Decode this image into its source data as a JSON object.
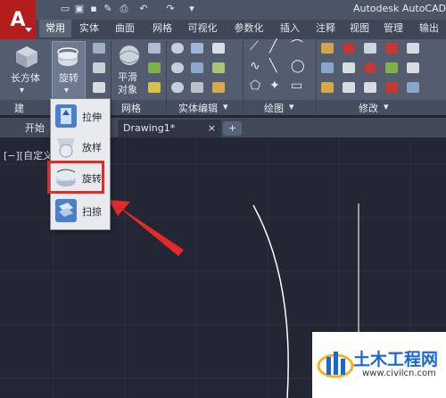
{
  "app": {
    "title": "Autodesk AutoCAD",
    "logo": "A"
  },
  "quick_access": [
    "new-icon",
    "open-icon",
    "save-icon",
    "saveas-icon",
    "print-icon",
    "undo-icon",
    "redo-icon"
  ],
  "ribbon_tabs": [
    "常用",
    "实体",
    "曲面",
    "网格",
    "可视化",
    "参数化",
    "插入",
    "注释",
    "视图",
    "管理",
    "输出"
  ],
  "active_tab": "常用",
  "ribbon": {
    "box_label": "长方体",
    "revolve_label": "旋转",
    "smooth_label_1": "平滑",
    "smooth_label_2": "对象",
    "panels": {
      "modeling": "建",
      "mesh": "网格",
      "solid_edit": "实体编辑",
      "draw": "绘图",
      "modify": "修改"
    }
  },
  "doc_tabs": {
    "start": "开始",
    "drawing": "Drawing1*",
    "add": "+"
  },
  "viewport_label": "[−][自定义",
  "dropdown": {
    "items": [
      {
        "label": "拉伸",
        "icon": "extrude-icon"
      },
      {
        "label": "放样",
        "icon": "loft-icon"
      },
      {
        "label": "旋转",
        "icon": "revolve-icon"
      },
      {
        "label": "扫掠",
        "icon": "sweep-icon"
      }
    ]
  },
  "colors": {
    "accent_red": "#e12b2b",
    "canvas": "#222733",
    "ribbon": "#535d6f"
  },
  "watermark": {
    "name": "土木工程网",
    "url": "www.civilcn.com"
  }
}
